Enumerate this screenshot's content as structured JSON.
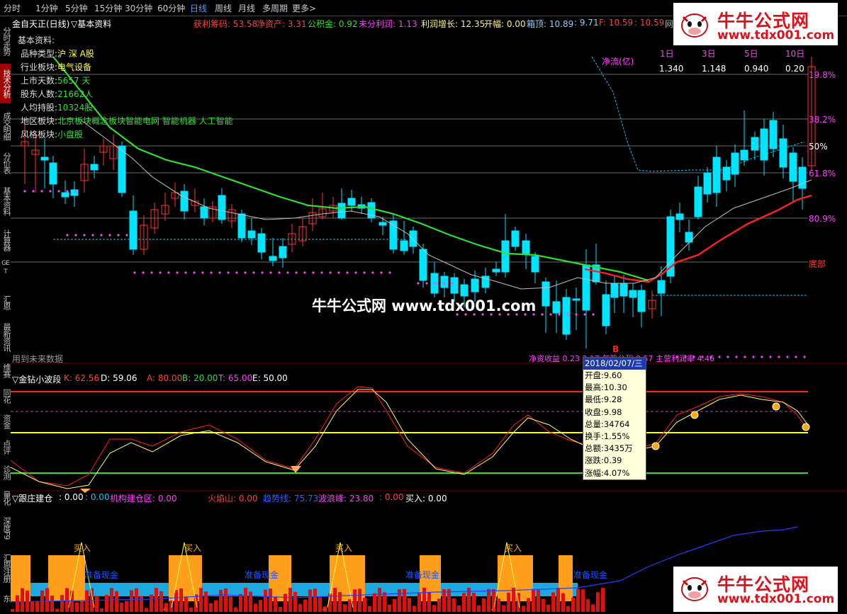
{
  "tabs": [
    "分时",
    "1分钟",
    "5分钟",
    "15分钟",
    "30分钟",
    "60分钟",
    "日线",
    "周线",
    "月线",
    "多周期",
    "更多>"
  ],
  "active_tab": "日线",
  "sidebar": [
    "分时走势",
    "技术分析",
    "成交明细",
    "分价表",
    "基本资料",
    "计算器",
    "GET",
    "汇恩",
    "最新资讯",
    "维赛",
    "同花",
    "资金",
    "点评",
    "诊测",
    "量化",
    "深度F9",
    "汇恩注册",
    "东"
  ],
  "stock": {
    "name": "金自天正(日线)",
    "indicator": "▽基本资料"
  },
  "info": {
    "l1": "获利筹码: 53.58",
    "l2": "净资产: 3.31",
    "l3": "公积金: 0.92",
    "l4": "未分利润: 1.13",
    "l5": "利润增长: 12.35",
    "l6": "开幅: 0.00",
    "l7": "箱顶: 10.89",
    "l8": ": 9.71",
    "l9": "F: 10.59",
    "l10": ": 10.59",
    "l11": "网"
  },
  "basic": {
    "title": "基本资料:",
    "rows": [
      {
        "k": "品种类型:",
        "v": "沪 深 A股"
      },
      {
        "k": "行业板块:",
        "v": "电气设备"
      },
      {
        "k": "上市天数:",
        "v": "5657 天"
      },
      {
        "k": "股东人数:",
        "v": "21662人"
      },
      {
        "k": "人均持股:",
        "v": "10324股"
      },
      {
        "k": "地区板块:",
        "v": "北京板块概念板块智能电网 智能机器 人工智能"
      },
      {
        "k": "风格板块:",
        "v": "小盘股"
      }
    ]
  },
  "flow": {
    "title": "净流(亿)",
    "headers": [
      "1日",
      "3日",
      "5日",
      "10日"
    ],
    "values": [
      "1.340",
      "1.148",
      "0.940",
      "0.20"
    ]
  },
  "fib": [
    "19.8%",
    "38.2%",
    "50%",
    "61.8%",
    "80.9%",
    "底部"
  ],
  "main_bottom": {
    "future": "用到未来数据",
    "bottom_text": "净资收益 0.23  2.17  每股公积 0.57  主营利润率 4.46",
    "b_mark": "B"
  },
  "watermark": "牛牛公式网 www.tdx001.com",
  "tooltip": {
    "date": "2018/02/07/三",
    "rows": [
      "开盘:9.60",
      "最高:10.30",
      "最低:9.28",
      "收盘:9.98",
      "总量:34764",
      "换手:1.55%",
      "总额:3435万",
      "涨跌:0.39",
      "涨幅:4.07%"
    ]
  },
  "p2": {
    "title": "▽金钻小波段",
    "k": "K: 62.56",
    "d": "D: 59.06",
    "a": "A: 80.00",
    "b": "B: 20.00",
    "t": "T: 65.00",
    "e": "E: 50.00"
  },
  "p3": {
    "title": "▽跟庄建仓",
    "v1": ": 0.00",
    "v2": ": 0.00",
    "v3": "机构建仓区: 0.00",
    "v4": "火焰山: 0.00",
    "v5": "趋势线: 75.73",
    "v6": "波浪峰: 23.80",
    "v7": ": 0.00",
    "v8": "买入: 0.00",
    "buy": "买入",
    "cash": "准备现金"
  },
  "logo": {
    "name": "牛牛公式网",
    "url": "www.tdx001.com"
  },
  "colors": {
    "up": "#ff3232",
    "down": "#00e5ff",
    "ma_green": "#30e030",
    "ma_red": "#ff2020",
    "panel_bg": "#000000"
  }
}
